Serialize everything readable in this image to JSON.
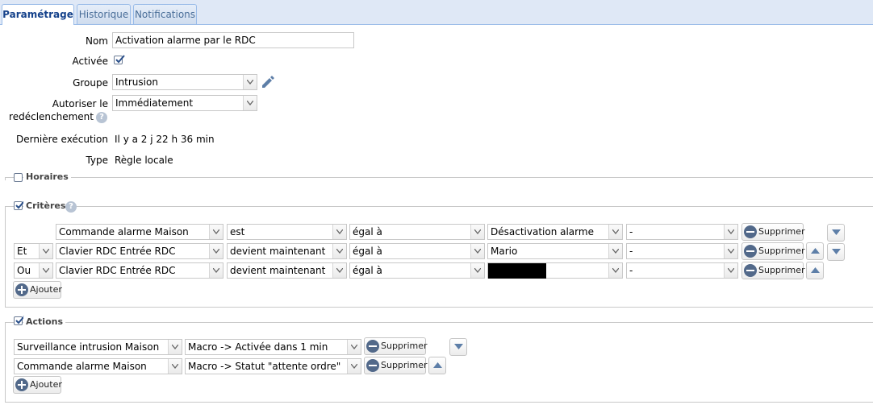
{
  "tabs": [
    "Paramétrage",
    "Historique",
    "Notifications"
  ],
  "form": {
    "nom_label": "Nom",
    "nom_value": "Activation alarme par le RDC",
    "activee_label": "Activée",
    "groupe_label": "Groupe",
    "groupe_value": "Intrusion",
    "autoriser_label_line1": "Autoriser le",
    "autoriser_label_line2": "redéclenchement",
    "autoriser_value": "Immédiatement",
    "derniere_label": "Dernière exécution",
    "derniere_value": "Il y a 2 j 22 h 36 min",
    "type_label": "Type",
    "type_value": "Règle locale"
  },
  "horaires": {
    "legend": "Horaires",
    "checked": false
  },
  "criteres": {
    "legend": "Critères",
    "checked": true,
    "rows": [
      {
        "op": "",
        "device": "Commande alarme Maison",
        "verb": "est",
        "cmp": "égal à",
        "value": "Désactivation alarme",
        "extra": "-"
      },
      {
        "op": "Et",
        "device": "Clavier RDC Entrée RDC",
        "verb": "devient maintenant",
        "cmp": "égal à",
        "value": "Mario",
        "extra": "-"
      },
      {
        "op": "Ou",
        "device": "Clavier RDC Entrée RDC",
        "verb": "devient maintenant",
        "cmp": "égal à",
        "value": "",
        "extra": "-"
      }
    ],
    "supprimer_label": "Supprimer",
    "ajouter_label": "Ajouter"
  },
  "actions": {
    "legend": "Actions",
    "checked": true,
    "rows": [
      {
        "device": "Surveillance intrusion Maison",
        "action": "Macro -> Activée dans 1 min"
      },
      {
        "device": "Commande alarme Maison",
        "action": "Macro -> Statut \"attente ordre\""
      }
    ],
    "supprimer_label": "Supprimer",
    "ajouter_label": "Ajouter"
  },
  "colors": {
    "accent": "#15428b",
    "tab_border": "#99bbe8",
    "button_icon": "#52698a"
  }
}
